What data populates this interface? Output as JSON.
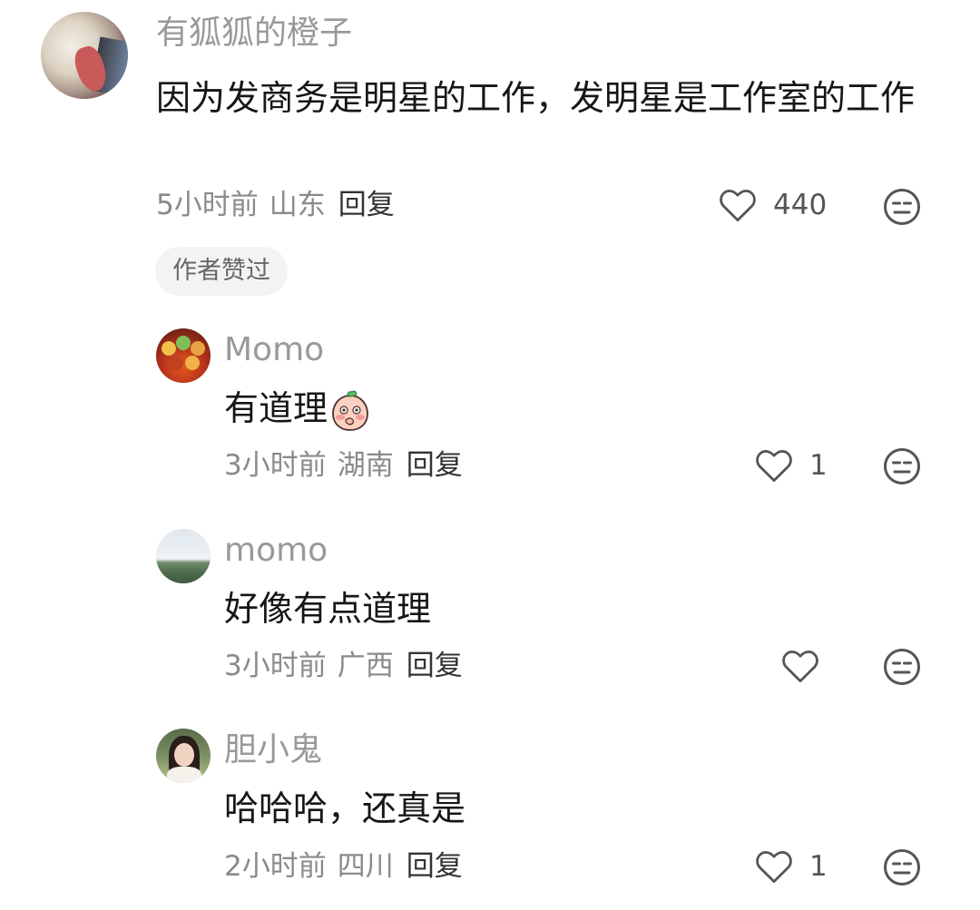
{
  "comments": [
    {
      "username": "有狐狐的橙子",
      "text": "因为发商务是明星的工作，发明星是工作室的工作",
      "time": "5小时前",
      "location": "山东",
      "reply_label": "回复",
      "likes": "440",
      "badge": "作者赞过"
    },
    {
      "username": "Momo",
      "text": "有道理",
      "time": "3小时前",
      "location": "湖南",
      "reply_label": "回复",
      "likes": "1"
    },
    {
      "username": "momo",
      "text": "好像有点道理",
      "time": "3小时前",
      "location": "广西",
      "reply_label": "回复",
      "likes": ""
    },
    {
      "username": "胆小鬼",
      "text": "哈哈哈，还真是",
      "time": "2小时前",
      "location": "四川",
      "reply_label": "回复",
      "likes": "1"
    }
  ],
  "icons": {
    "like": "heart-outline-icon",
    "reaction": "meh-face-icon",
    "emoji": "peach-blush-emoji"
  },
  "colors": {
    "username": "#999999",
    "text": "#161616",
    "meta": "#8a8a8a",
    "badge_bg": "#f3f3f3"
  }
}
